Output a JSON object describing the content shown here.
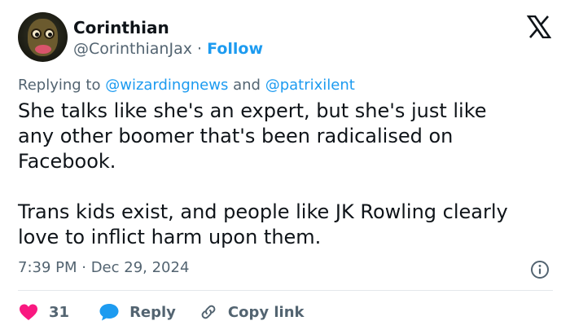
{
  "author": {
    "name": "Corinthian",
    "handle": "@CorinthianJax",
    "separator": "·",
    "follow_label": "Follow"
  },
  "reply_context": {
    "prefix": "Replying to",
    "mention_1": "@wizardingnews",
    "conjunction": "and",
    "mention_2": "@patrixilent"
  },
  "tweet": {
    "lines": [
      "She talks like she's an expert, but she's just like",
      "any other boomer that's been radicalised on",
      "Facebook.",
      "Trans kids exist, and people like JK Rowling clearly",
      "love to inflict harm upon them."
    ],
    "timestamp": "7:39 PM · Dec 29, 2024"
  },
  "actions": {
    "like_count": "31",
    "reply_label": "Reply",
    "copy_link_label": "Copy link"
  },
  "icons": {
    "logo": "x-logo-icon",
    "info": "info-icon",
    "like": "heart-icon",
    "reply": "speech-bubble-icon",
    "copy": "link-icon"
  },
  "colors": {
    "accent": "#1d9bf0",
    "like": "#f91880",
    "secondary_text": "#536471",
    "primary_text": "#0f1419"
  }
}
